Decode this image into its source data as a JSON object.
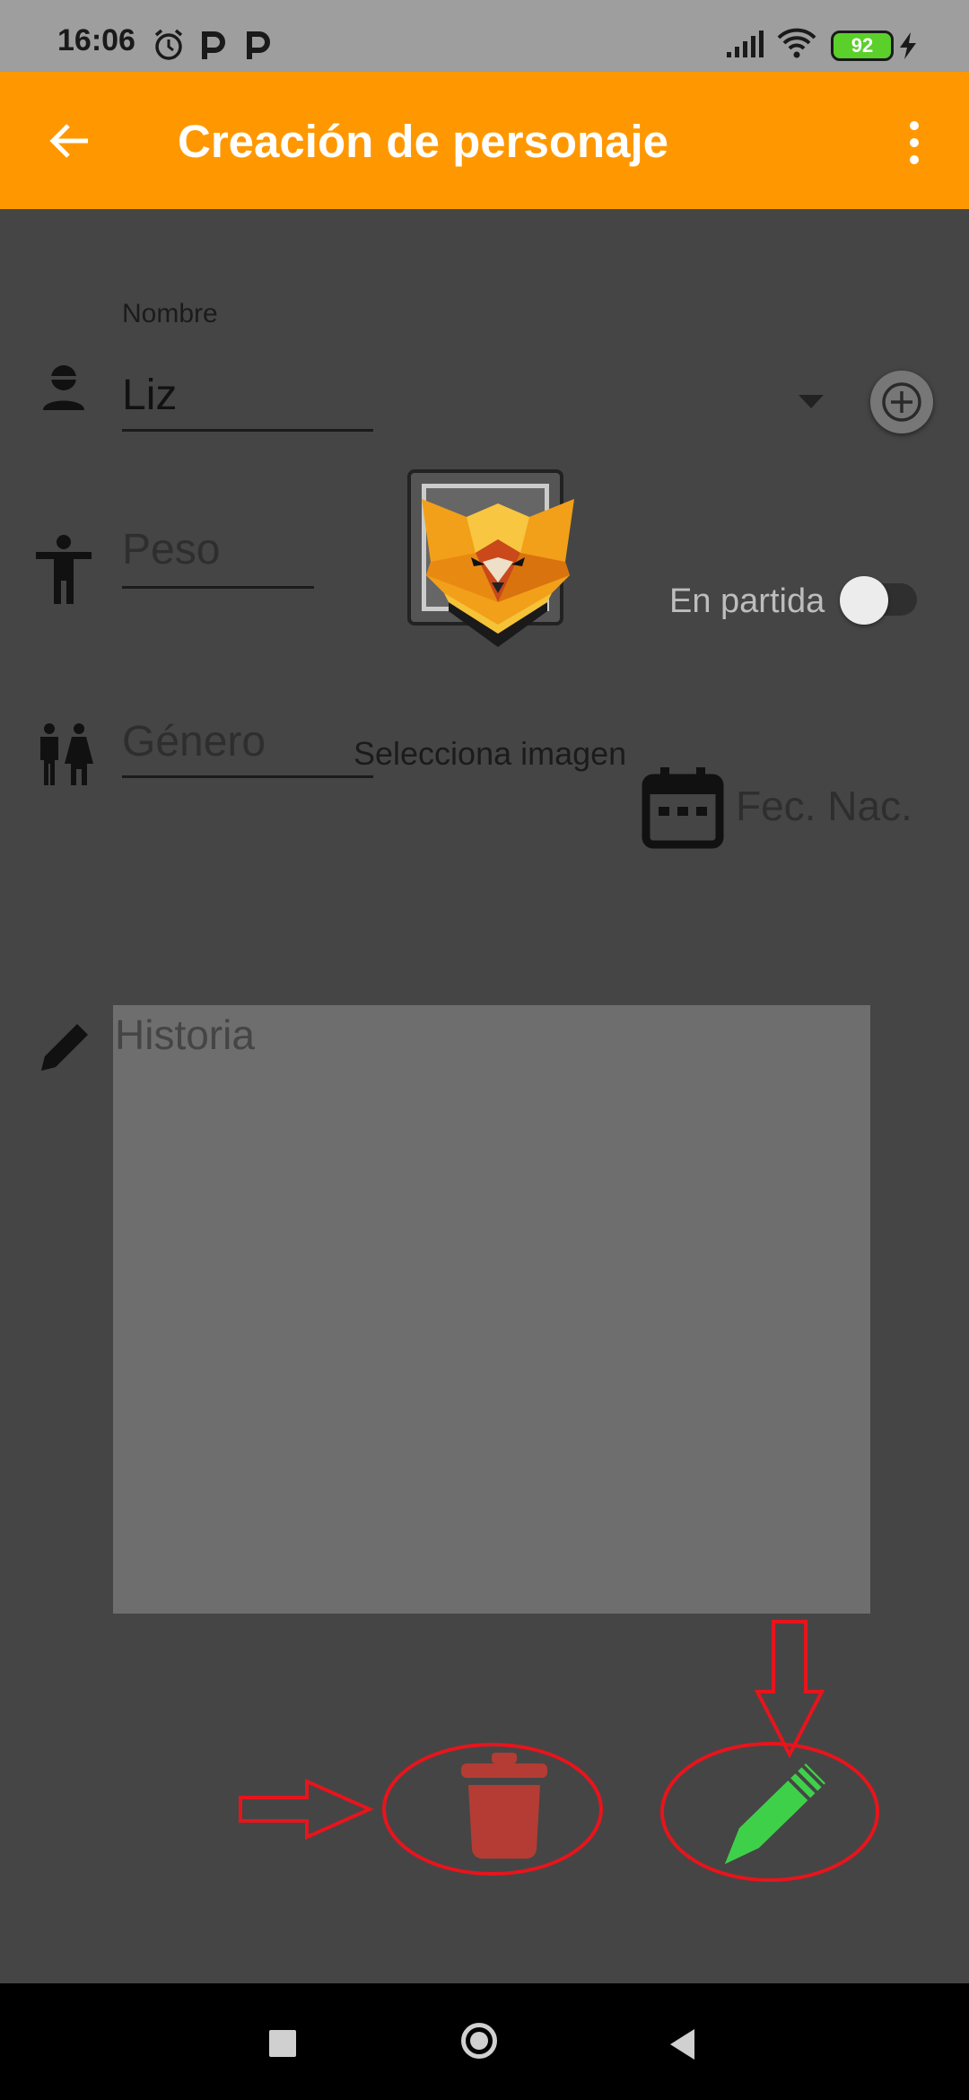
{
  "status": {
    "time": "16:06",
    "battery": "92"
  },
  "appbar": {
    "title": "Creación de personaje"
  },
  "form": {
    "nombre_label": "Nombre",
    "nombre_value": "Liz",
    "peso_placeholder": "Peso",
    "genero_placeholder": "Género",
    "select_image_label": "Selecciona imagen",
    "en_partida_label": "En partida",
    "fec_nac_label": "Fec. Nac.",
    "historia_placeholder": "Historia"
  },
  "colors": {
    "appbar": "#ff9800",
    "background": "#454545",
    "delete_icon": "#b43c34",
    "edit_icon": "#3fd04a",
    "annotation": "#e8141c"
  },
  "icons": [
    "back-arrow-icon",
    "more-vert-icon",
    "person-icon",
    "accessibility-icon",
    "wc-icon",
    "calendar-icon",
    "pencil-icon",
    "add-circle-icon",
    "dropdown-arrow-icon",
    "trash-icon",
    "edit-pencil-icon",
    "nav-square-icon",
    "nav-circle-icon",
    "nav-back-icon"
  ]
}
